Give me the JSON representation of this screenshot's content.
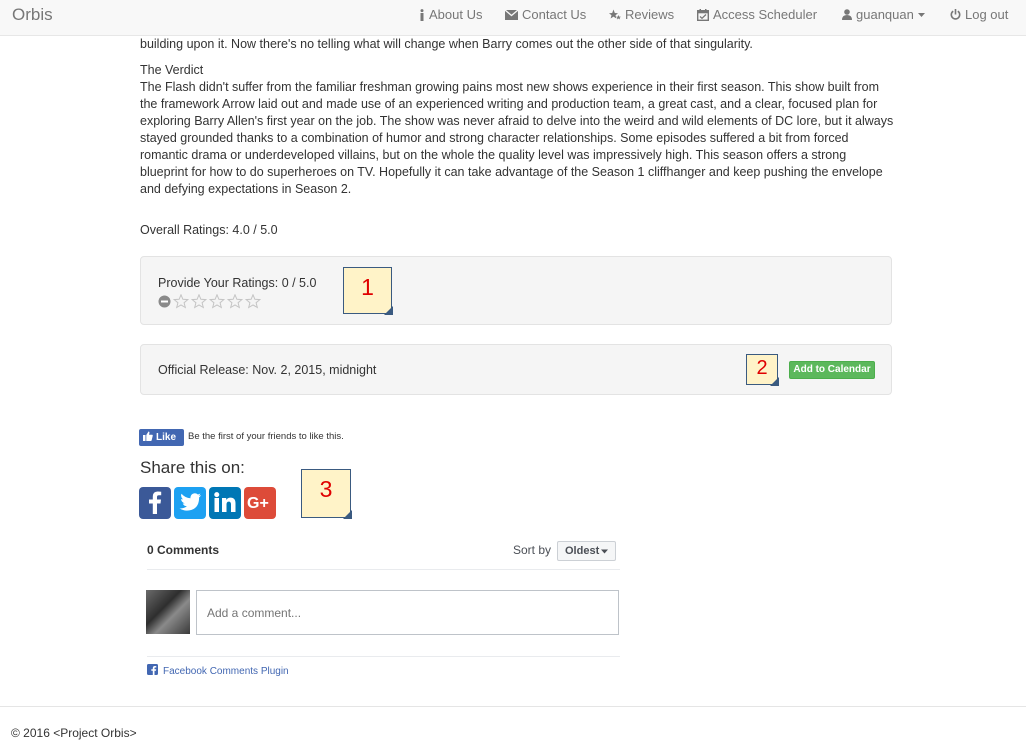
{
  "navbar": {
    "brand": "Orbis",
    "items": [
      {
        "label": "About Us",
        "icon": "info-icon"
      },
      {
        "label": "Contact Us",
        "icon": "envelope-icon"
      },
      {
        "label": "Reviews",
        "icon": "stars-icon"
      },
      {
        "label": "Access Scheduler",
        "icon": "calendar-icon"
      },
      {
        "label": "guanquan",
        "icon": "user-icon"
      },
      {
        "label": "Log out",
        "icon": "power-icon"
      }
    ]
  },
  "article": {
    "top_line": "building upon it. Now there's no telling what will change when Barry comes out the other side of that singularity.",
    "verdict_title": "The Verdict",
    "verdict_lines": [
      "The Flash didn't suffer from the familiar freshman growing pains most new shows experience in their first season. This show built from",
      "the framework Arrow laid out and made use of an experienced writing and production team, a great cast, and a clear, focused plan for",
      "exploring Barry Allen's first year on the job. The show was never afraid to delve into the weird and wild elements of DC lore, but it always",
      "stayed grounded thanks to a combination of humor and strong character relationships. Some episodes suffered a bit from forced",
      "romantic drama or underdeveloped villains, but on the whole the quality level was impressively high. This season offers a strong",
      "blueprint for how to do superheroes on TV. Hopefully it can take advantage of the Season 1 cliffhanger and keep pushing the envelope",
      "and defying expectations in Season 2."
    ]
  },
  "ratings": {
    "overall": "Overall Ratings: 4.0 / 5.0",
    "provide": "Provide Your Ratings: 0 / 5.0",
    "user_stars": 0,
    "max_stars": 5
  },
  "release": {
    "label": "Official Release: Nov. 2, 2015, midnight",
    "calendar_button": "Add to Calendar"
  },
  "callouts": [
    "1",
    "2",
    "3"
  ],
  "social": {
    "like_button": "Like",
    "like_text": "Be the first of your friends to like this.",
    "share_title": "Share this on:",
    "share_buttons": [
      {
        "icon": "facebook-icon",
        "color": "#3b5998"
      },
      {
        "icon": "twitter-icon",
        "color": "#1da1f2"
      },
      {
        "icon": "linkedin-icon",
        "color": "#0077b5"
      },
      {
        "icon": "google-plus-icon",
        "color": "#dd4b39"
      }
    ]
  },
  "comments": {
    "count_label": "0 Comments",
    "sort_label": "Sort by",
    "sort_value": "Oldest",
    "input_placeholder": "Add a comment...",
    "plugin_label": "Facebook Comments Plugin"
  },
  "footer": {
    "text": "© 2016 <Project Orbis>"
  },
  "colors": {
    "accent_green": "#5cb85c",
    "facebook_blue": "#4267b2",
    "callout_fill": "#fff3c8",
    "callout_text": "#e00000"
  }
}
